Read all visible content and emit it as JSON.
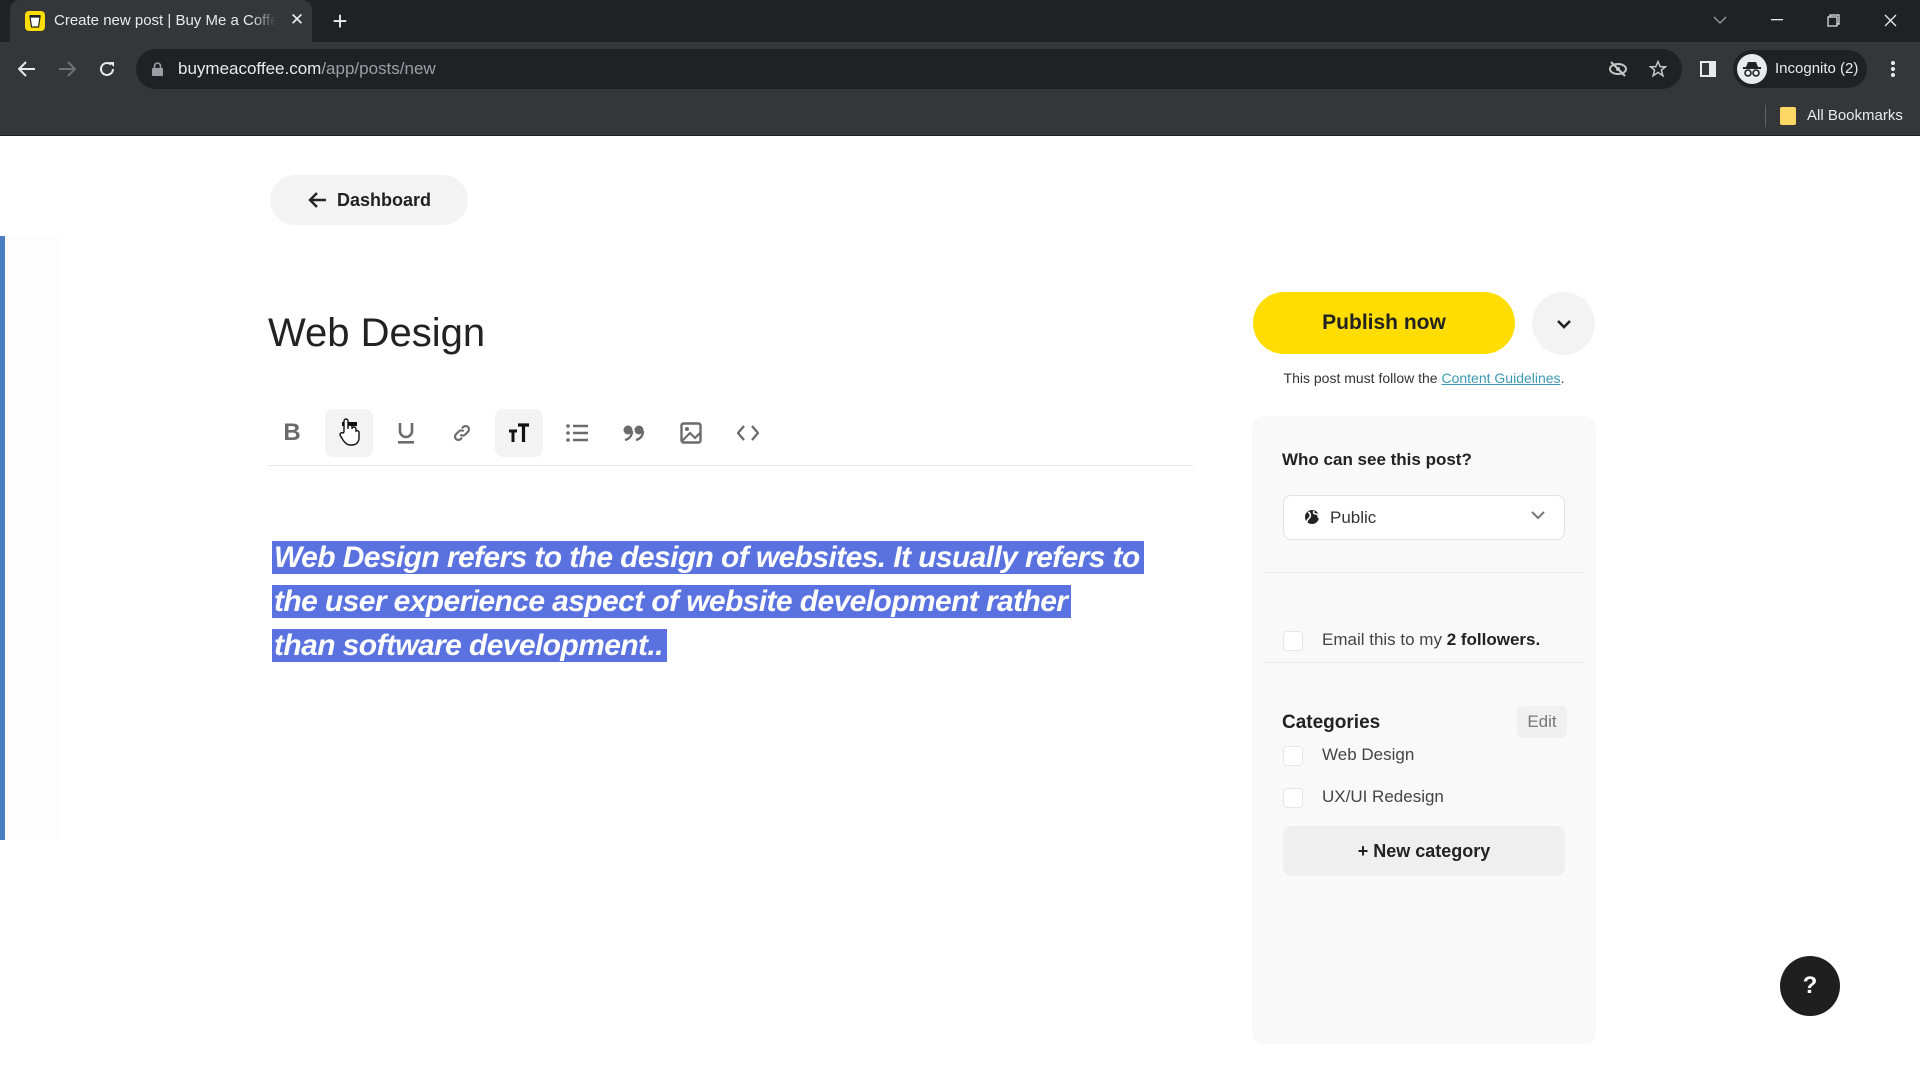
{
  "browser": {
    "tab_title": "Create new post | Buy Me a Coffee",
    "url_domain": "buymeacoffee.com",
    "url_path": "/app/posts/new",
    "profile_label": "Incognito (2)",
    "bookmarks_label": "All Bookmarks",
    "icons": {
      "favicon": "buy-me-a-coffee-cup-icon",
      "close_tab": "close-icon",
      "new_tab": "plus-icon",
      "back": "arrow-left-icon",
      "forward": "arrow-right-icon",
      "reload": "reload-icon",
      "lock": "lock-icon",
      "eye_slash": "eye-slash-icon",
      "star": "star-icon",
      "side_panel": "side-panel-icon",
      "incognito": "incognito-icon",
      "menu": "kebab-menu-icon"
    }
  },
  "page": {
    "back_button_label": "Dashboard",
    "post_title": "Web Design",
    "toolbar": [
      {
        "name": "bold",
        "icon": "bold-icon",
        "glyph": "B",
        "active": false
      },
      {
        "name": "italic",
        "icon": "italic-icon",
        "glyph": "T",
        "active": true
      },
      {
        "name": "underline",
        "icon": "underline-icon",
        "glyph": "U",
        "active": false
      },
      {
        "name": "link",
        "icon": "link-icon",
        "active": false
      },
      {
        "name": "heading",
        "icon": "text-size-icon",
        "glyph": "TT",
        "active": true
      },
      {
        "name": "bulleted-list",
        "icon": "list-icon",
        "active": false
      },
      {
        "name": "quote",
        "icon": "quote-icon",
        "glyph": "99",
        "active": false
      },
      {
        "name": "image",
        "icon": "image-icon",
        "active": false
      },
      {
        "name": "code",
        "icon": "code-icon",
        "glyph": "<>",
        "active": false
      }
    ],
    "body_lines": [
      "Web Design refers to the design of websites. It usually refers to",
      "the user experience aspect of website development rather",
      "than software development.."
    ],
    "selection_color": "#5a72e0"
  },
  "sidebar": {
    "publish_label": "Publish now",
    "publish_color": "#ffdd00",
    "guidelines_prefix": "This post must follow the ",
    "guidelines_link": "Content Guidelines",
    "guidelines_suffix": ".",
    "visibility_label": "Who can see this post?",
    "visibility_value": "Public",
    "email_prefix": "Email this to my ",
    "email_bold": "2 followers.",
    "email_checked": false,
    "categories_title": "Categories",
    "categories_edit": "Edit",
    "categories": [
      {
        "label": "Web Design",
        "checked": false
      },
      {
        "label": "UX/UI Redesign",
        "checked": false
      }
    ],
    "new_category_label": "+ New category"
  },
  "help_button_label": "?"
}
